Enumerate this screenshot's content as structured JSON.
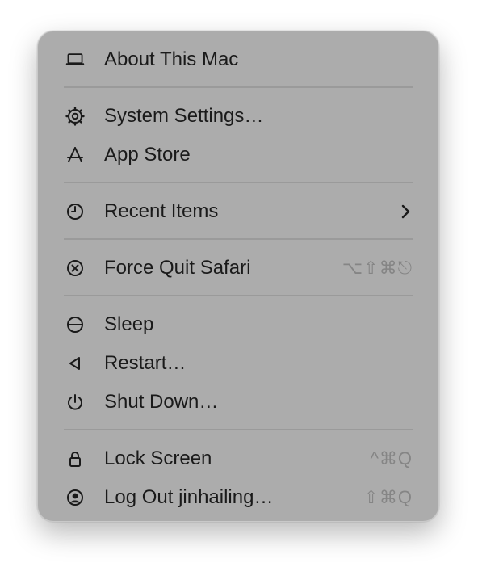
{
  "menu": {
    "about": {
      "label": "About This Mac",
      "icon": "laptop-icon"
    },
    "settings": {
      "label": "System Settings…",
      "icon": "gear-icon"
    },
    "app_store": {
      "label": "App Store",
      "icon": "app-store-icon"
    },
    "recent": {
      "label": "Recent Items",
      "icon": "clock-icon",
      "submenu_indicator": "chevron-right-icon"
    },
    "force_quit": {
      "label": "Force Quit Safari",
      "icon": "force-quit-icon",
      "shortcut": "⌥⇧⌘⎋"
    },
    "sleep": {
      "label": "Sleep",
      "icon": "sleep-icon"
    },
    "restart": {
      "label": "Restart…",
      "icon": "restart-icon"
    },
    "shutdown": {
      "label": "Shut Down…",
      "icon": "power-icon"
    },
    "lock": {
      "label": "Lock Screen",
      "icon": "lock-icon",
      "shortcut": "^⌘Q"
    },
    "logout": {
      "label": "Log Out jinhailing…",
      "icon": "user-icon",
      "shortcut": "⇧⌘Q"
    }
  },
  "colors": {
    "menu_background": "#acacac",
    "text": "#1a1a1a",
    "shortcut_text": "#858585",
    "separator": "#9a9a9a"
  }
}
